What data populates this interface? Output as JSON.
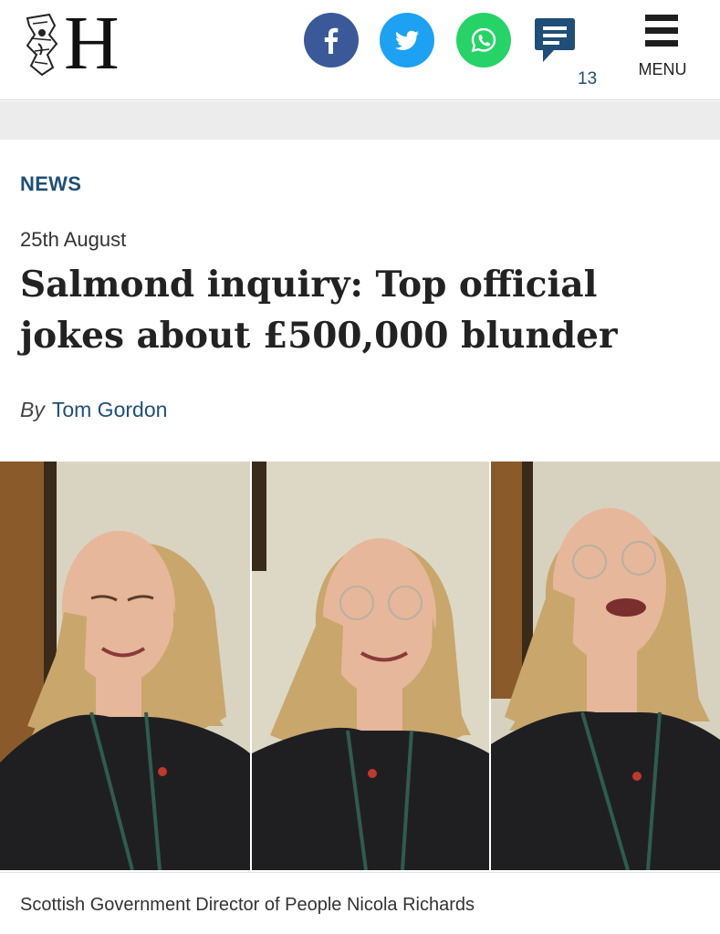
{
  "brand": {
    "logo_letter": "H"
  },
  "share": {
    "facebook_icon": "facebook-icon",
    "twitter_icon": "twitter-icon",
    "whatsapp_icon": "whatsapp-icon",
    "comments_icon": "comment-icon",
    "comment_count": "13"
  },
  "menu": {
    "label": "MENU",
    "icon": "hamburger-menu-icon"
  },
  "article": {
    "section": "NEWS",
    "date": "25th August",
    "headline": "Salmond inquiry: Top official jokes about £500,000 blunder",
    "by_label": "By",
    "author": "Tom Gordon",
    "image_caption": "Scottish Government Director of People Nicola Richards"
  },
  "colors": {
    "accent_blue": "#1f4e79",
    "facebook": "#3b5998",
    "twitter": "#1da1f2",
    "whatsapp": "#25d366"
  }
}
